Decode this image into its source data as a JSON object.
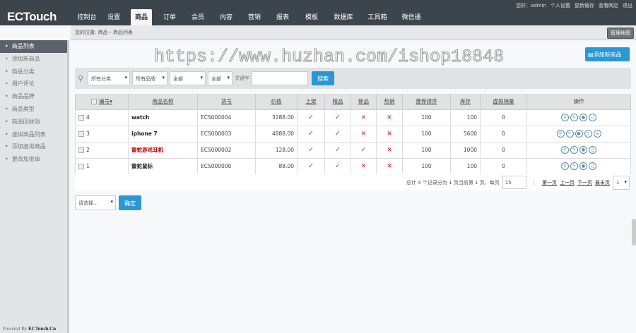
{
  "logo": "ECTouch",
  "nav": [
    "控制台",
    "设置",
    "商品",
    "订单",
    "会员",
    "内容",
    "营销",
    "报表",
    "模板",
    "数据库",
    "工具箱",
    "微信通"
  ],
  "nav_active": 2,
  "toplinks": [
    "您好：admin",
    "个人设置",
    "更新缓存",
    "查看网店",
    "退出"
  ],
  "breadcrumb": "您的位置: 商品 › 商品列表",
  "map_button": "管理地图",
  "sidebar": [
    "商品列表",
    "添加新商品",
    "商品分类",
    "用户评论",
    "商品品牌",
    "商品类型",
    "商品回收站",
    "虚拟商品列表",
    "添加虚拟商品",
    "更改加密串"
  ],
  "powered_prefix": "Powered By ",
  "powered_brand": "ECTouch.Cn",
  "watermark": "https://www.huzhan.com/ishop18848",
  "add_button": "添加新商品",
  "filter": {
    "category": "所有分类",
    "brand": "所有品牌",
    "status1": "全部",
    "status2": "全部",
    "keyword_label": "关键字",
    "keyword_value": "",
    "search": "搜索"
  },
  "columns": [
    "编号",
    "商品名称",
    "货号",
    "价格",
    "上架",
    "精品",
    "新品",
    "热销",
    "推荐排序",
    "库存",
    "虚拟销量",
    "操作"
  ],
  "rows": [
    {
      "id": "4",
      "name": "watch",
      "sn": "ECS000004",
      "price": "3288.00",
      "onsale": true,
      "best": true,
      "new": false,
      "hot": false,
      "sort": "100",
      "stock": "100",
      "virtual": "0",
      "red": false,
      "extra": false
    },
    {
      "id": "3",
      "name": "iphone 7",
      "sn": "ECS000003",
      "price": "4888.00",
      "onsale": true,
      "best": true,
      "new": false,
      "hot": false,
      "sort": "100",
      "stock": "5600",
      "virtual": "0",
      "red": false,
      "extra": true
    },
    {
      "id": "2",
      "name": "雷蛇游戏耳机",
      "sn": "ECS000002",
      "price": "128.00",
      "onsale": true,
      "best": true,
      "new": true,
      "hot": false,
      "sort": "100",
      "stock": "1000",
      "virtual": "0",
      "red": true,
      "extra": false
    },
    {
      "id": "1",
      "name": "雷蛇鼠标",
      "sn": "ECS000000",
      "price": "88.00",
      "onsale": true,
      "best": true,
      "new": false,
      "hot": false,
      "sort": "100",
      "stock": "100",
      "virtual": "0",
      "red": false,
      "extra": false
    }
  ],
  "pager": {
    "summary": "总计 4 个记录分为 1 页当前第 1 页，每页",
    "per_page": "15",
    "first": "第一页",
    "prev": "上一页",
    "next": "下一页",
    "last": "最末页",
    "page": "1"
  },
  "batch": {
    "select": "请选择...",
    "confirm": "确定"
  }
}
